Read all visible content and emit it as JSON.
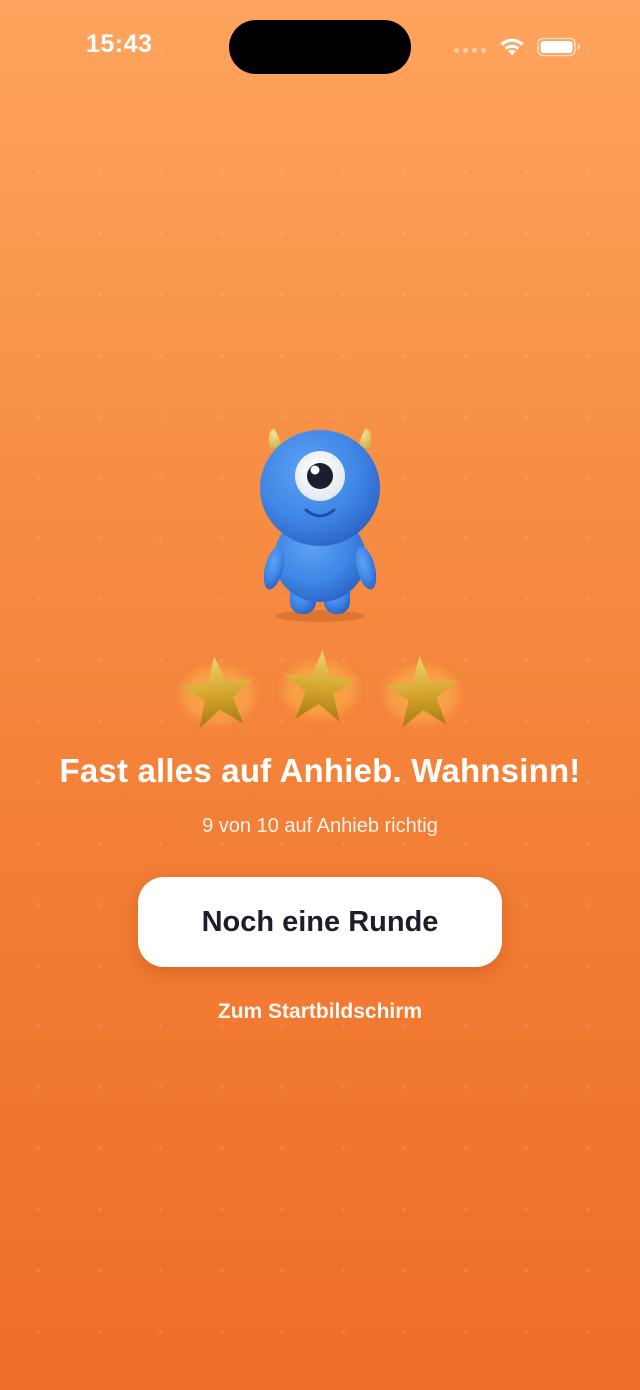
{
  "status_bar": {
    "time": "15:43",
    "icons": [
      "cellular-signal-icon",
      "wifi-icon",
      "battery-icon"
    ]
  },
  "result": {
    "mascot": "blue-cyclops-monster",
    "stars_earned": 3,
    "stars_total": 3,
    "headline": "Fast alles auf Anhieb. Wahnsinn!",
    "summary": "9 von 10 auf Anhieb richtig"
  },
  "actions": {
    "primary_label": "Noch eine Runde",
    "secondary_label": "Zum Startbildschirm"
  },
  "colors": {
    "background_top": "#FFA45E",
    "background_bottom": "#EE6E27",
    "primary_text": "#1C1F2B",
    "star_gold": "#D4A52C",
    "mascot_blue": "#3F86E6"
  }
}
